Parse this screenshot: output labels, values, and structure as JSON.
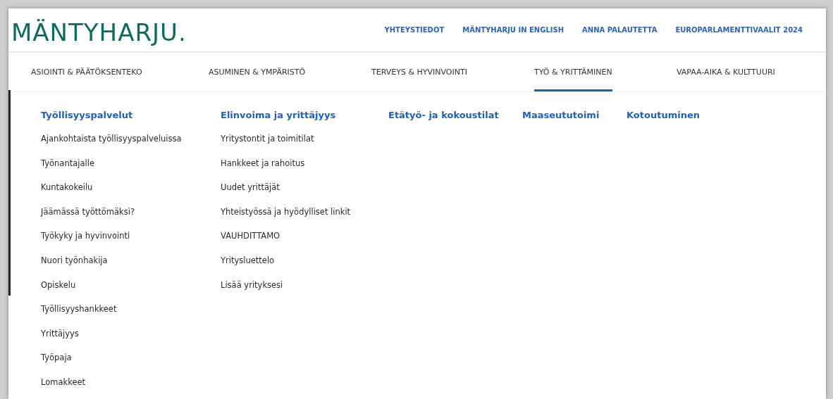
{
  "logo": "MÄNTYHARJU.",
  "top_links": [
    "YHTEYSTIEDOT",
    "MÄNTYHARJU IN ENGLISH",
    "ANNA PALAUTETTA",
    "EUROPARLAMENTTIVAALIT 2024"
  ],
  "nav": [
    {
      "label": "ASIOINTI & PÄÄTÖKSENTEKO",
      "selected": false
    },
    {
      "label": "ASUMINEN & YMPÄRISTÖ",
      "selected": false
    },
    {
      "label": "TERVEYS & HYVINVOINTI",
      "selected": false
    },
    {
      "label": "TYÖ & YRITTÄMINEN",
      "selected": true
    },
    {
      "label": "VAPAA-AIKA & KULTTUURI",
      "selected": false
    }
  ],
  "menu_columns": [
    {
      "heading": "Työllisyyspalvelut",
      "items": [
        "Ajankohtaista työllisyyspalveluissa",
        "Työnantajalle",
        "Kuntakokeilu",
        "Jäämässä työttömäksi?",
        "Työkyky ja hyvinvointi",
        "Nuori työnhakija",
        "Opiskelu",
        "Työllisyyshankkeet",
        "Yrittäjyys",
        "Työpaja",
        "Lomakkeet"
      ]
    },
    {
      "heading": "Elinvoima ja yrittäjyys",
      "items": [
        "Yritystontit ja toimitilat",
        "Hankkeet ja rahoitus",
        "Uudet yrittäjät",
        "Yhteistyössä ja hyödylliset linkit",
        "VAUHDITTAMO",
        "Yritysluettelo",
        "Lisää yrityksesi"
      ]
    },
    {
      "heading": "Etätyö- ja kokoustilat"
    },
    {
      "heading": "Maaseututoimi"
    },
    {
      "heading": "Kotoutuminen"
    }
  ]
}
